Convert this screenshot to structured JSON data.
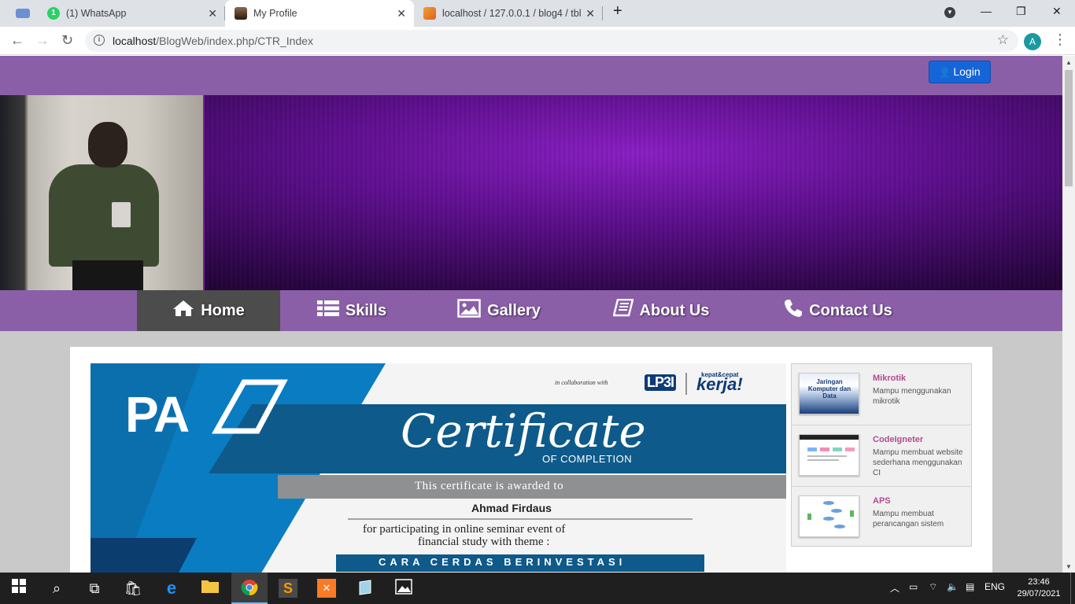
{
  "browser": {
    "tabs": [
      {
        "label": "",
        "active": false
      },
      {
        "label": "(1) WhatsApp",
        "badge": "1",
        "active": false
      },
      {
        "label": "My Profile",
        "active": true
      },
      {
        "label": "localhost / 127.0.0.1 / blog4 / tbl",
        "active": false
      }
    ],
    "new_tab": "+",
    "url_host": "localhost",
    "url_path": "/BlogWeb/index.php/CTR_Index",
    "profile_initial": "A"
  },
  "header": {
    "login_label": "Login"
  },
  "nav": {
    "items": [
      {
        "label": "Home",
        "icon": "home-icon",
        "active": true
      },
      {
        "label": "Skills",
        "icon": "list-icon",
        "active": false
      },
      {
        "label": "Gallery",
        "icon": "picture-icon",
        "active": false
      },
      {
        "label": "About Us",
        "icon": "book-icon",
        "active": false
      },
      {
        "label": "Contact Us",
        "icon": "phone-icon",
        "active": false
      }
    ]
  },
  "certificate": {
    "collab_text": "in collaboration with",
    "brand_left": "PA",
    "brand_lp3i": "LP3I",
    "brand_kerja_top": "kepat&cepat",
    "brand_kerja": "kerja!",
    "title": "Certificate",
    "subtitle": "OF COMPLETION",
    "awarded_text": "This certificate is awarded to",
    "recipient": "Ahmad Firdaus",
    "body_line1": "for participating in online seminar event of",
    "body_line2": "financial study with theme :",
    "theme": "CARA CERDAS BERINVESTASI"
  },
  "skills": [
    {
      "title": "Mikrotik",
      "desc": "Mampu menggunakan mikrotik",
      "thumb_text": "Jaringan Komputer dan Data"
    },
    {
      "title": "CodeIgneter",
      "desc": "Mampu membuat website sederhana menggunakan CI",
      "thumb_text": ""
    },
    {
      "title": "APS",
      "desc": "Mampu membuat perancangan sistem",
      "thumb_text": ""
    }
  ],
  "taskbar": {
    "language": "ENG",
    "time": "23:46",
    "date": "29/07/2021"
  },
  "colors": {
    "header_purple": "#8a5fa8",
    "nav_active": "#4c4c4c",
    "login_blue": "#1565d8",
    "skill_title": "#b24d8e",
    "cert_blue": "#0a7cc2",
    "cert_dark": "#0e5a8a"
  }
}
